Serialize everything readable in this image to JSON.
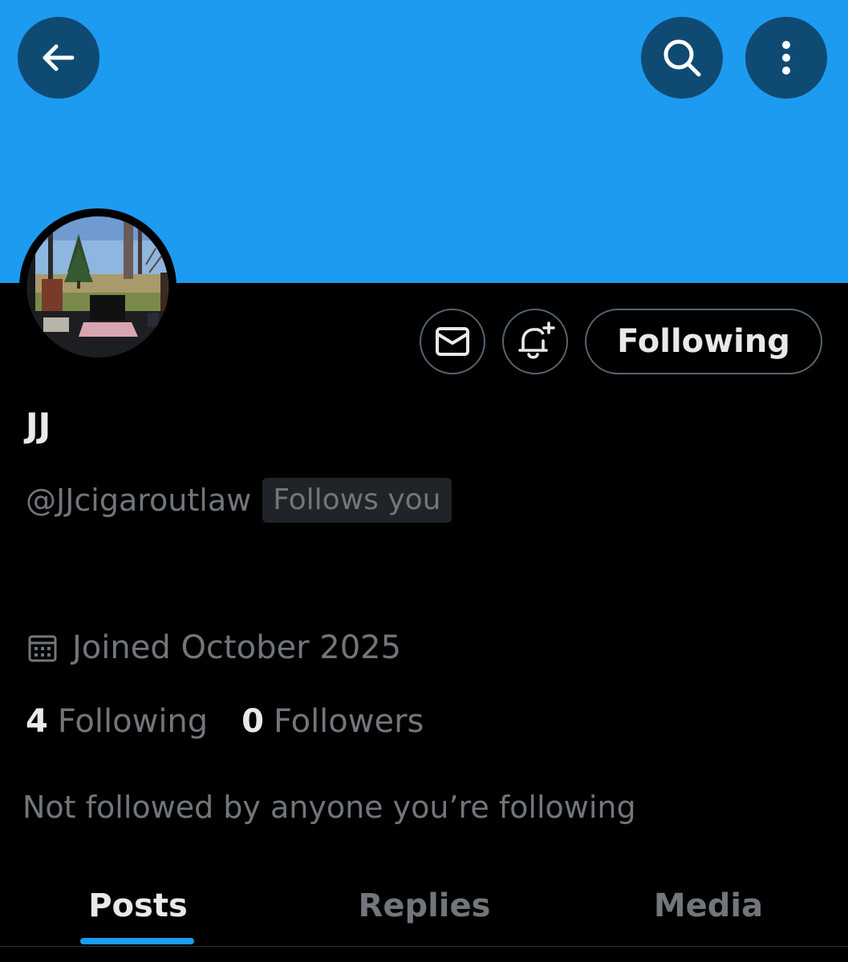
{
  "colors": {
    "banner": "#1d9bf0",
    "accent": "#1d9bf0",
    "background": "#000000",
    "primary_text": "#e7e9ea",
    "secondary_text": "#71767b",
    "header_button": "#0f4a73"
  },
  "header": {
    "back_icon": "arrow-left-icon",
    "search_icon": "search-icon",
    "more_icon": "more-vertical-icon"
  },
  "profile": {
    "display_name": "JJ",
    "handle": "@JJcigaroutlaw",
    "follows_you_badge": "Follows you",
    "joined": "Joined October 2025",
    "following_count": "4",
    "following_label": "Following",
    "followers_count": "0",
    "followers_label": "Followers",
    "social_context": "Not followed by anyone you’re following"
  },
  "actions": {
    "message_icon": "envelope-icon",
    "notify_icon": "bell-plus-icon",
    "following_button_label": "Following"
  },
  "tabs": [
    {
      "label": "Posts",
      "active": true
    },
    {
      "label": "Replies",
      "active": false
    },
    {
      "label": "Media",
      "active": false
    }
  ]
}
